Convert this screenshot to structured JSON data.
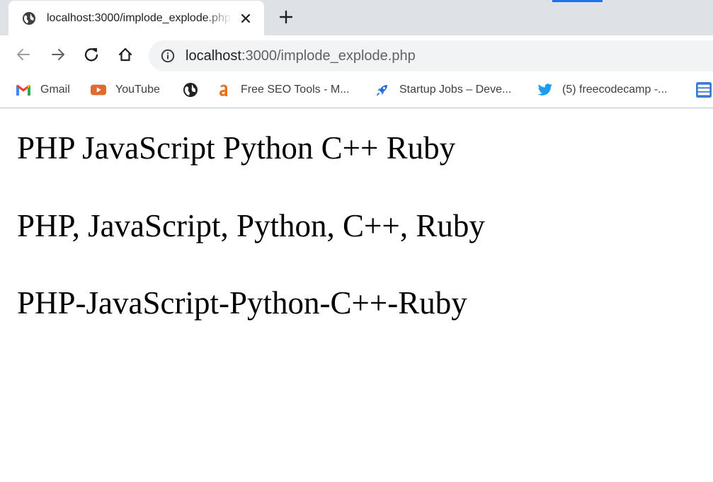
{
  "browser": {
    "tab": {
      "title": "localhost:3000/implode_explode.php",
      "favicon": "globe-icon",
      "close_icon": "close-icon"
    },
    "new_tab_icon": "plus-icon",
    "toolbar": {
      "back_icon": "arrow-left-icon",
      "forward_icon": "arrow-right-icon",
      "reload_icon": "reload-icon",
      "home_icon": "home-icon"
    },
    "omnibox": {
      "info_icon": "info-icon",
      "url_host": "localhost",
      "url_path": ":3000/implode_explode.php"
    },
    "bookmarks": [
      {
        "label": "Gmail",
        "icon": "gmail-icon"
      },
      {
        "label": "YouTube",
        "icon": "youtube-icon"
      },
      {
        "label": "",
        "icon": "globe-icon"
      },
      {
        "label": "Free SEO Tools - M...",
        "icon": "seo-tools-icon"
      },
      {
        "label": "Startup Jobs – Deve...",
        "icon": "rocket-icon"
      },
      {
        "label": "(5) freecodecamp -...",
        "icon": "twitter-icon"
      },
      {
        "label": "",
        "icon": "bookmark-list-icon"
      }
    ]
  },
  "page": {
    "lines": [
      "PHP JavaScript Python C++ Ruby",
      "PHP, JavaScript, Python, C++, Ruby",
      "PHP-JavaScript-Python-C++-Ruby"
    ]
  },
  "colors": {
    "tabstrip_bg": "#dee1e6",
    "omnibox_bg": "#f1f3f4",
    "accent": "#1a73e8",
    "youtube_red": "#e06b2c",
    "twitter_blue": "#1d9bf0",
    "seo_orange": "#e8711a"
  }
}
